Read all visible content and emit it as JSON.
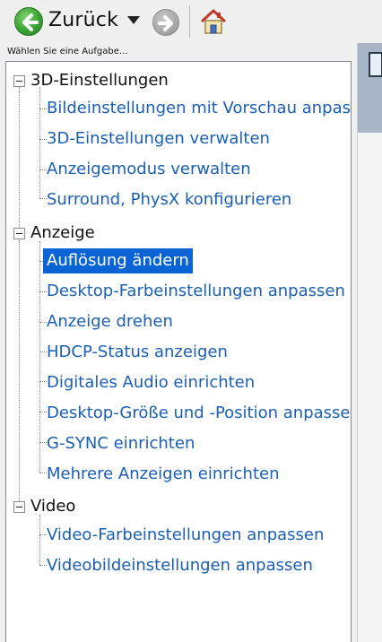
{
  "toolbar": {
    "back_label": "Zurück",
    "icons": [
      "back-arrow-icon",
      "chevron-down-icon",
      "forward-arrow-icon",
      "home-icon"
    ]
  },
  "task_header": "Wählen Sie eine Aufgabe...",
  "tree": {
    "categories": [
      {
        "label": "3D-Einstellungen",
        "items": [
          "Bildeinstellungen mit Vorschau anpassen",
          "3D-Einstellungen verwalten",
          "Anzeigemodus verwalten",
          "Surround, PhysX konfigurieren"
        ]
      },
      {
        "label": "Anzeige",
        "items": [
          "Auflösung ändern",
          "Desktop-Farbeinstellungen anpassen",
          "Anzeige drehen",
          "HDCP-Status anzeigen",
          "Digitales Audio einrichten",
          "Desktop-Größe und -Position anpassen",
          "G-SYNC einrichten",
          "Mehrere Anzeigen einrichten"
        ]
      },
      {
        "label": "Video",
        "items": [
          "Video-Farbeinstellungen anpassen",
          "Videobildeinstellungen anpassen"
        ]
      }
    ],
    "selected": "Auflösung ändern"
  },
  "colors": {
    "link": "#1a5fb4",
    "selected_bg": "#0a64d6",
    "back_button": "#3aa335"
  }
}
